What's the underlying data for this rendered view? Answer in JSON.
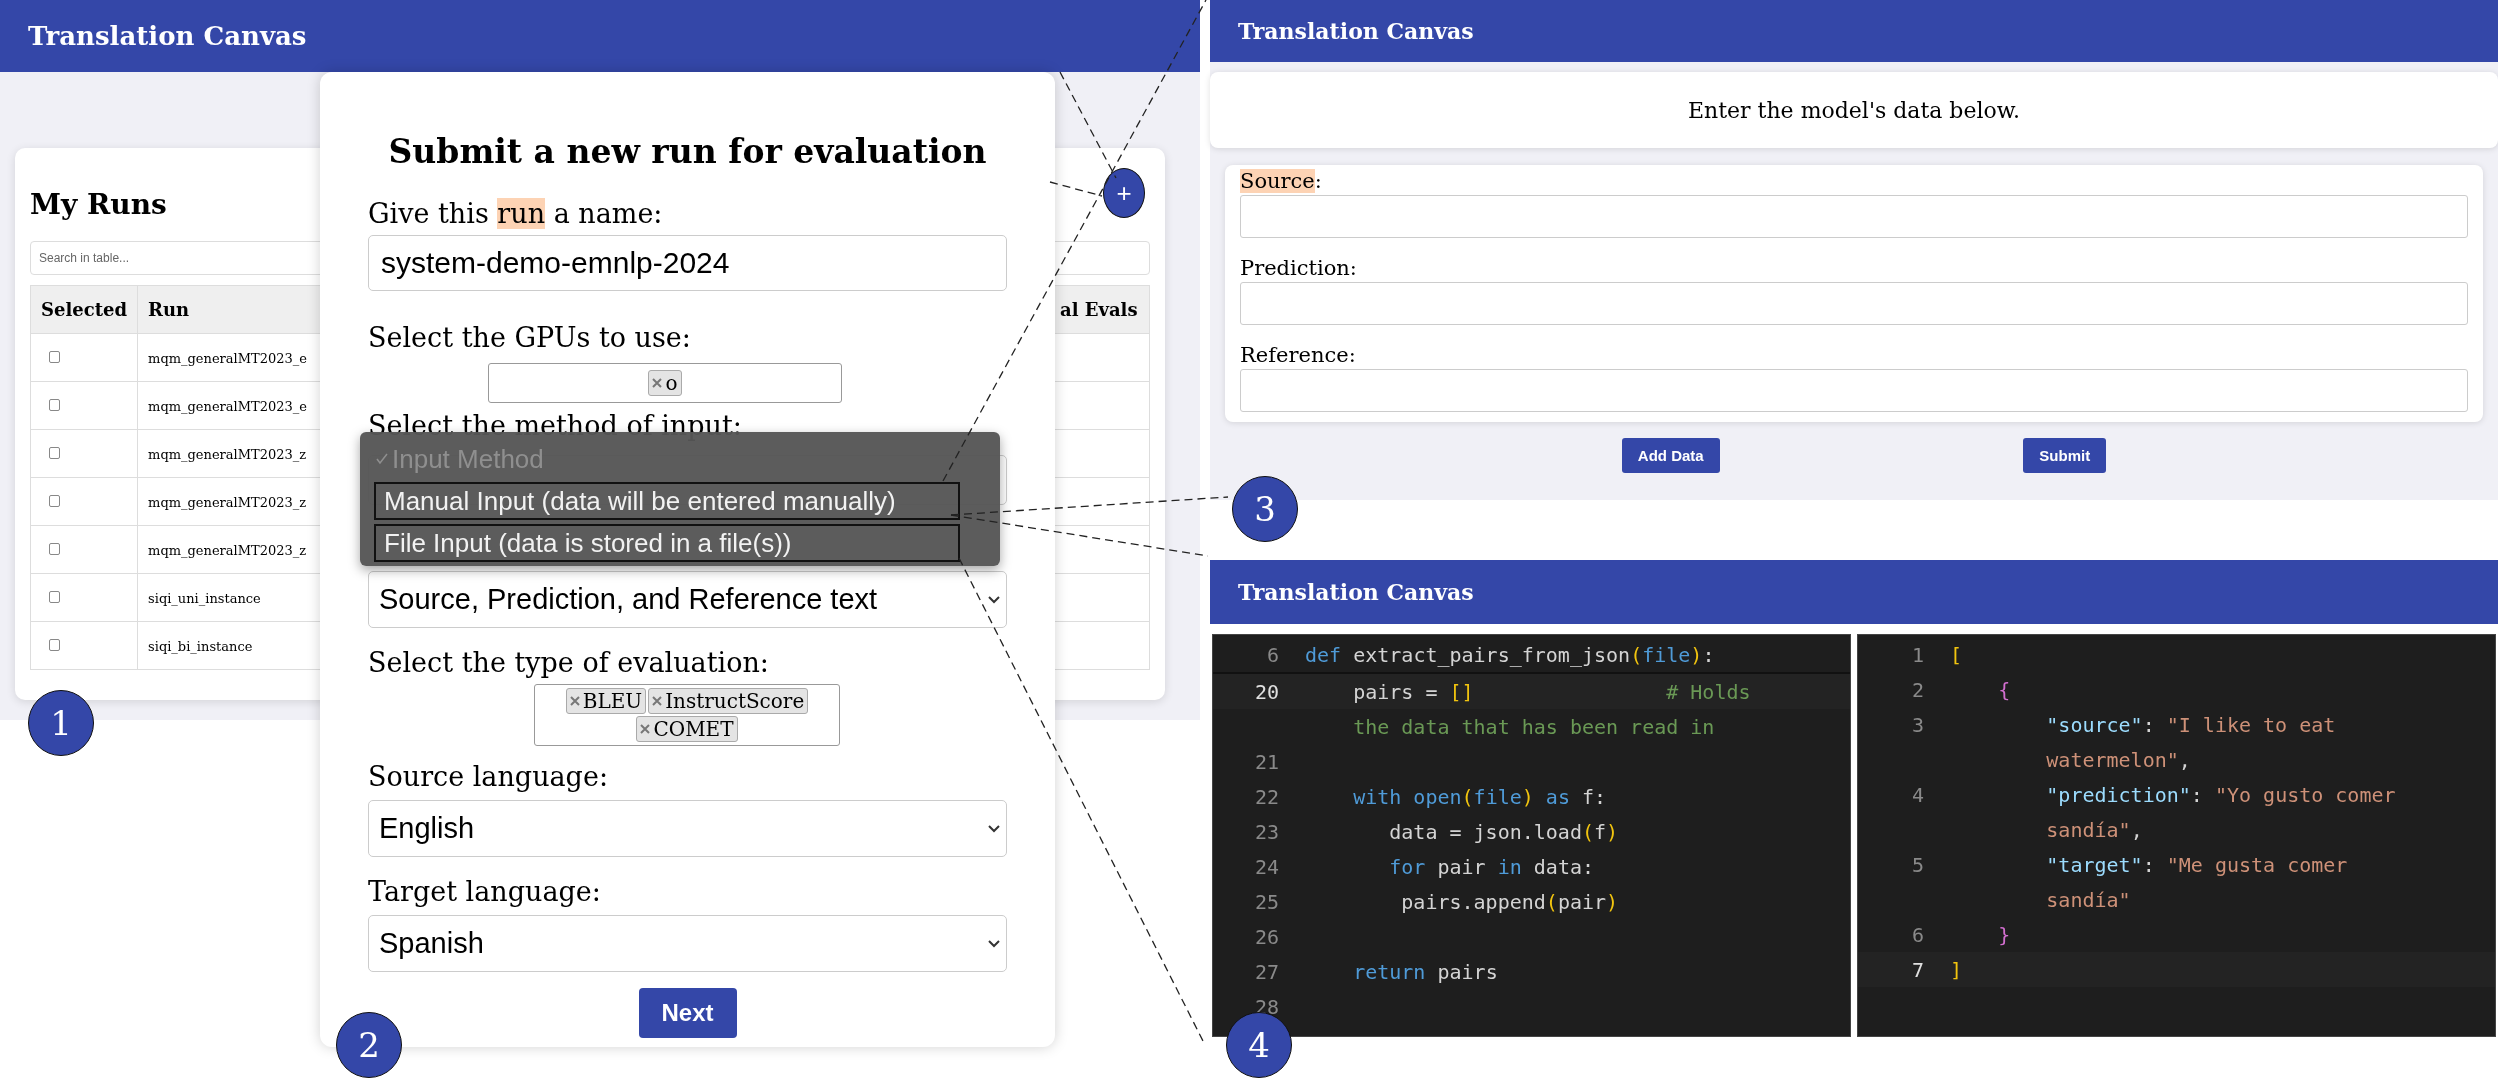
{
  "runs_screen": {
    "app_title": "Translation Canvas",
    "heading": "My Runs",
    "search": {
      "placeholder": "Search in table..."
    },
    "add_button": {
      "label": "+"
    },
    "columns": [
      "Selected",
      "Run",
      "al Evals"
    ],
    "rows": [
      {
        "selected": false,
        "run": "mqm_generalMT2023_e"
      },
      {
        "selected": false,
        "run": "mqm_generalMT2023_e"
      },
      {
        "selected": false,
        "run": "mqm_generalMT2023_z"
      },
      {
        "selected": false,
        "run": "mqm_generalMT2023_z"
      },
      {
        "selected": false,
        "run": "mqm_generalMT2023_z"
      },
      {
        "selected": false,
        "run": "siqi_uni_instance"
      },
      {
        "selected": false,
        "run": "siqi_bi_instance"
      }
    ]
  },
  "submit_dialog": {
    "title": "Submit a new run for evaluation",
    "name_label": {
      "before": "Give this",
      "highlighted": "run",
      "after": "a name:"
    },
    "name_value": "system-demo-emnlp-2024",
    "gpu_label": "Select the GPUs to use:",
    "gpu_tags": [
      "o"
    ],
    "method_label": "Select the method of input:",
    "method_menu": [
      {
        "label": "Input Method",
        "checked": true,
        "disabled": true
      },
      {
        "label": "Manual Input (data will be entered manually)",
        "checked": false,
        "disabled": false
      },
      {
        "label": "File Input (data is stored in a file(s))",
        "checked": false,
        "disabled": false
      }
    ],
    "data_select_value": "Source, Prediction, and Reference text",
    "evaluation_label": "Select the type of evaluation:",
    "evaluation_tags": [
      "BLEU",
      "InstructScore",
      "COMET"
    ],
    "source_language_label": "Source language:",
    "source_language": "English",
    "target_language_label": "Target language:",
    "target_language": "Spanish",
    "next_button": "Next"
  },
  "manual_input_screen": {
    "app_title": "Translation Canvas",
    "intro": "Enter the model's data below.",
    "fields": [
      {
        "label": "Source",
        "suffix": ":",
        "highlighted": true
      },
      {
        "label": "Prediction",
        "suffix": ":",
        "highlighted": false
      },
      {
        "label": "Reference",
        "suffix": ":",
        "highlighted": false
      }
    ],
    "buttons": [
      "Add Data",
      "Submit"
    ]
  },
  "file_input_screen": {
    "app_title": "Translation Canvas",
    "python_editor": {
      "sticky_line": {
        "number": "6",
        "tokens": [
          {
            "kind": "keyword",
            "text": "def "
          },
          {
            "kind": "plain",
            "text": "extract_pairs_from_json"
          },
          {
            "kind": "paren",
            "text": "("
          },
          {
            "kind": "keyword",
            "text": "file"
          },
          {
            "kind": "paren",
            "text": ")"
          },
          {
            "kind": "plain",
            "text": ":"
          }
        ]
      },
      "lines": [
        {
          "number": "20",
          "current": true,
          "tokens": [
            {
              "kind": "plain",
              "text": "    pairs = "
            },
            {
              "kind": "paren",
              "text": "[]"
            },
            {
              "kind": "comment",
              "text": "                # Holds"
            }
          ]
        },
        {
          "tokens": [
            {
              "kind": "comment",
              "text": "    the data that has been read in"
            }
          ]
        },
        {
          "number": "21",
          "current": false
        },
        {
          "number": "22",
          "current": false,
          "tokens": [
            {
              "kind": "keyword",
              "text": "    with open"
            },
            {
              "kind": "paren",
              "text": "("
            },
            {
              "kind": "keyword",
              "text": "file"
            },
            {
              "kind": "paren",
              "text": ")"
            },
            {
              "kind": "keyword",
              "text": " as"
            },
            {
              "kind": "plain",
              "text": " f:"
            }
          ]
        },
        {
          "number": "23",
          "current": false,
          "tokens": [
            {
              "kind": "plain",
              "text": "       data = json.load"
            },
            {
              "kind": "paren",
              "text": "("
            },
            {
              "kind": "plain",
              "text": "f"
            },
            {
              "kind": "paren",
              "text": ")"
            }
          ]
        },
        {
          "number": "24",
          "current": false,
          "tokens": [
            {
              "kind": "keyword",
              "text": "       for"
            },
            {
              "kind": "plain",
              "text": " pair "
            },
            {
              "kind": "keyword",
              "text": "in"
            },
            {
              "kind": "plain",
              "text": " data:"
            }
          ]
        },
        {
          "number": "25",
          "current": false,
          "tokens": [
            {
              "kind": "plain",
              "text": "        pairs.append"
            },
            {
              "kind": "paren",
              "text": "("
            },
            {
              "kind": "plain",
              "text": "pair"
            },
            {
              "kind": "paren",
              "text": ")"
            }
          ]
        },
        {
          "number": "26",
          "current": false
        },
        {
          "number": "27",
          "current": false,
          "tokens": [
            {
              "kind": "keyword",
              "text": "    return"
            },
            {
              "kind": "plain",
              "text": " pairs"
            }
          ]
        },
        {
          "number": "28",
          "current": false
        }
      ]
    },
    "json_editor": {
      "lines": [
        {
          "number": "1",
          "current": false,
          "tokens": [
            {
              "kind": "paren",
              "text": "["
            }
          ]
        },
        {
          "number": "2",
          "current": false,
          "tokens": [
            {
              "kind": "brace",
              "text": "    {"
            }
          ]
        },
        {
          "number": "3",
          "current": false,
          "tokens": [
            {
              "kind": "key",
              "text": "        \"source\""
            },
            {
              "kind": "plain",
              "text": ": "
            },
            {
              "kind": "string",
              "text": "\"I like to eat"
            }
          ]
        },
        {
          "tokens": [
            {
              "kind": "string",
              "text": "        watermelon\""
            },
            {
              "kind": "plain",
              "text": ","
            }
          ]
        },
        {
          "number": "4",
          "current": false,
          "tokens": [
            {
              "kind": "key",
              "text": "        \"prediction\""
            },
            {
              "kind": "plain",
              "text": ": "
            },
            {
              "kind": "string",
              "text": "\"Yo gusto comer"
            }
          ]
        },
        {
          "tokens": [
            {
              "kind": "string",
              "text": "        sandía\""
            },
            {
              "kind": "plain",
              "text": ","
            }
          ]
        },
        {
          "number": "5",
          "current": false,
          "tokens": [
            {
              "kind": "key",
              "text": "        \"target\""
            },
            {
              "kind": "plain",
              "text": ": "
            },
            {
              "kind": "string",
              "text": "\"Me gusta comer"
            }
          ]
        },
        {
          "tokens": [
            {
              "kind": "string",
              "text": "        sandía\""
            }
          ]
        },
        {
          "number": "6",
          "current": false,
          "tokens": [
            {
              "kind": "brace",
              "text": "    }"
            }
          ]
        },
        {
          "number": "7",
          "current": true,
          "tokens": [
            {
              "kind": "paren",
              "text": "]"
            }
          ]
        }
      ]
    }
  },
  "step_badges": [
    "1",
    "2",
    "3",
    "4"
  ]
}
